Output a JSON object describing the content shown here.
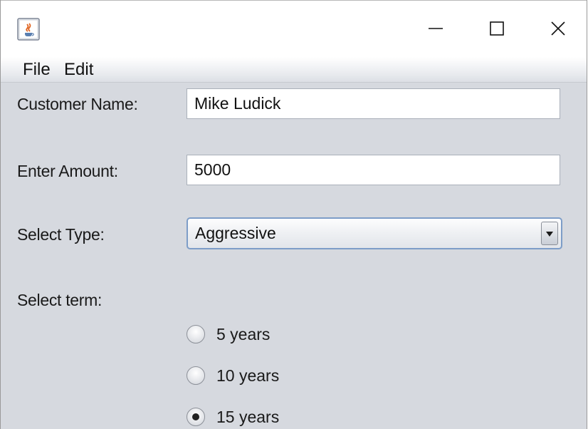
{
  "window": {
    "icon": "java-coffee-cup-icon",
    "controls": [
      "minimize-icon",
      "maximize-icon",
      "close-icon"
    ]
  },
  "menu": {
    "file": "File",
    "edit": "Edit"
  },
  "form": {
    "customer_name_label": "Customer Name:",
    "customer_name_value": "Mike Ludick",
    "amount_label": "Enter Amount:",
    "amount_value": "5000",
    "type_label": "Select Type:",
    "type_selected": "Aggressive",
    "term_label": "Select term:",
    "terms": [
      {
        "label": "5 years",
        "selected": false
      },
      {
        "label": "10 years",
        "selected": false
      },
      {
        "label": "15 years",
        "selected": true
      }
    ]
  }
}
